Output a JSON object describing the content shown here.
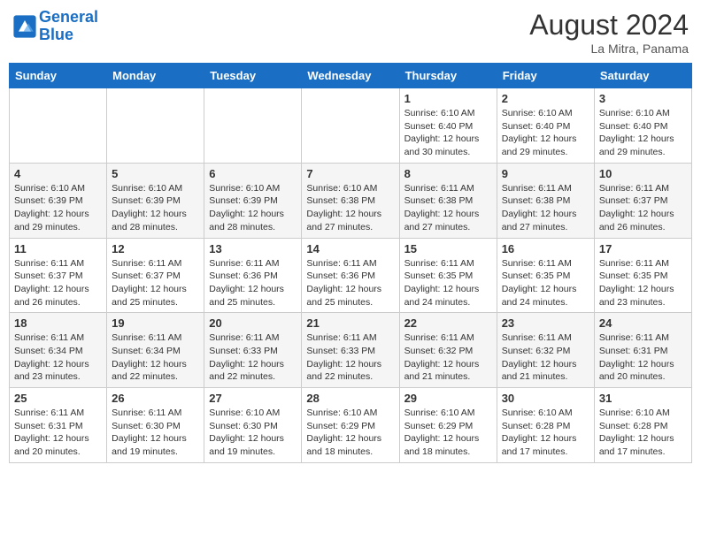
{
  "header": {
    "logo_line1": "General",
    "logo_line2": "Blue",
    "month_year": "August 2024",
    "location": "La Mitra, Panama"
  },
  "weekdays": [
    "Sunday",
    "Monday",
    "Tuesday",
    "Wednesday",
    "Thursday",
    "Friday",
    "Saturday"
  ],
  "weeks": [
    [
      {
        "day": "",
        "info": ""
      },
      {
        "day": "",
        "info": ""
      },
      {
        "day": "",
        "info": ""
      },
      {
        "day": "",
        "info": ""
      },
      {
        "day": "1",
        "info": "Sunrise: 6:10 AM\nSunset: 6:40 PM\nDaylight: 12 hours and 30 minutes."
      },
      {
        "day": "2",
        "info": "Sunrise: 6:10 AM\nSunset: 6:40 PM\nDaylight: 12 hours and 29 minutes."
      },
      {
        "day": "3",
        "info": "Sunrise: 6:10 AM\nSunset: 6:40 PM\nDaylight: 12 hours and 29 minutes."
      }
    ],
    [
      {
        "day": "4",
        "info": "Sunrise: 6:10 AM\nSunset: 6:39 PM\nDaylight: 12 hours and 29 minutes."
      },
      {
        "day": "5",
        "info": "Sunrise: 6:10 AM\nSunset: 6:39 PM\nDaylight: 12 hours and 28 minutes."
      },
      {
        "day": "6",
        "info": "Sunrise: 6:10 AM\nSunset: 6:39 PM\nDaylight: 12 hours and 28 minutes."
      },
      {
        "day": "7",
        "info": "Sunrise: 6:10 AM\nSunset: 6:38 PM\nDaylight: 12 hours and 27 minutes."
      },
      {
        "day": "8",
        "info": "Sunrise: 6:11 AM\nSunset: 6:38 PM\nDaylight: 12 hours and 27 minutes."
      },
      {
        "day": "9",
        "info": "Sunrise: 6:11 AM\nSunset: 6:38 PM\nDaylight: 12 hours and 27 minutes."
      },
      {
        "day": "10",
        "info": "Sunrise: 6:11 AM\nSunset: 6:37 PM\nDaylight: 12 hours and 26 minutes."
      }
    ],
    [
      {
        "day": "11",
        "info": "Sunrise: 6:11 AM\nSunset: 6:37 PM\nDaylight: 12 hours and 26 minutes."
      },
      {
        "day": "12",
        "info": "Sunrise: 6:11 AM\nSunset: 6:37 PM\nDaylight: 12 hours and 25 minutes."
      },
      {
        "day": "13",
        "info": "Sunrise: 6:11 AM\nSunset: 6:36 PM\nDaylight: 12 hours and 25 minutes."
      },
      {
        "day": "14",
        "info": "Sunrise: 6:11 AM\nSunset: 6:36 PM\nDaylight: 12 hours and 25 minutes."
      },
      {
        "day": "15",
        "info": "Sunrise: 6:11 AM\nSunset: 6:35 PM\nDaylight: 12 hours and 24 minutes."
      },
      {
        "day": "16",
        "info": "Sunrise: 6:11 AM\nSunset: 6:35 PM\nDaylight: 12 hours and 24 minutes."
      },
      {
        "day": "17",
        "info": "Sunrise: 6:11 AM\nSunset: 6:35 PM\nDaylight: 12 hours and 23 minutes."
      }
    ],
    [
      {
        "day": "18",
        "info": "Sunrise: 6:11 AM\nSunset: 6:34 PM\nDaylight: 12 hours and 23 minutes."
      },
      {
        "day": "19",
        "info": "Sunrise: 6:11 AM\nSunset: 6:34 PM\nDaylight: 12 hours and 22 minutes."
      },
      {
        "day": "20",
        "info": "Sunrise: 6:11 AM\nSunset: 6:33 PM\nDaylight: 12 hours and 22 minutes."
      },
      {
        "day": "21",
        "info": "Sunrise: 6:11 AM\nSunset: 6:33 PM\nDaylight: 12 hours and 22 minutes."
      },
      {
        "day": "22",
        "info": "Sunrise: 6:11 AM\nSunset: 6:32 PM\nDaylight: 12 hours and 21 minutes."
      },
      {
        "day": "23",
        "info": "Sunrise: 6:11 AM\nSunset: 6:32 PM\nDaylight: 12 hours and 21 minutes."
      },
      {
        "day": "24",
        "info": "Sunrise: 6:11 AM\nSunset: 6:31 PM\nDaylight: 12 hours and 20 minutes."
      }
    ],
    [
      {
        "day": "25",
        "info": "Sunrise: 6:11 AM\nSunset: 6:31 PM\nDaylight: 12 hours and 20 minutes."
      },
      {
        "day": "26",
        "info": "Sunrise: 6:11 AM\nSunset: 6:30 PM\nDaylight: 12 hours and 19 minutes."
      },
      {
        "day": "27",
        "info": "Sunrise: 6:10 AM\nSunset: 6:30 PM\nDaylight: 12 hours and 19 minutes."
      },
      {
        "day": "28",
        "info": "Sunrise: 6:10 AM\nSunset: 6:29 PM\nDaylight: 12 hours and 18 minutes."
      },
      {
        "day": "29",
        "info": "Sunrise: 6:10 AM\nSunset: 6:29 PM\nDaylight: 12 hours and 18 minutes."
      },
      {
        "day": "30",
        "info": "Sunrise: 6:10 AM\nSunset: 6:28 PM\nDaylight: 12 hours and 17 minutes."
      },
      {
        "day": "31",
        "info": "Sunrise: 6:10 AM\nSunset: 6:28 PM\nDaylight: 12 hours and 17 minutes."
      }
    ]
  ]
}
